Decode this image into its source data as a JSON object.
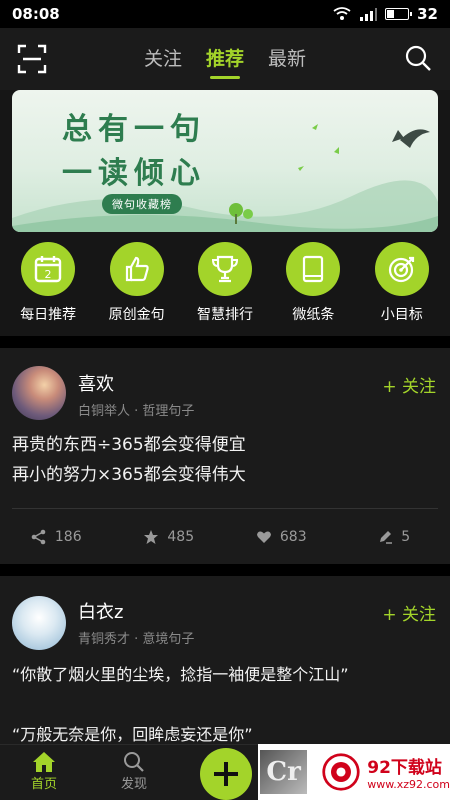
{
  "status_bar": {
    "time": "08:08",
    "battery": "32",
    "battery_level_percent": 32
  },
  "header": {
    "tabs": [
      {
        "label": "关注",
        "active": false
      },
      {
        "label": "推荐",
        "active": true
      },
      {
        "label": "最新",
        "active": false
      }
    ],
    "icons": {
      "left": "scan-icon",
      "right": "search-icon"
    }
  },
  "banner": {
    "line1": "总有一句",
    "line2": "一读倾心",
    "pill": "微句收藏榜"
  },
  "shortcuts": [
    {
      "label": "每日推荐",
      "icon": "calendar-icon",
      "badge": "2"
    },
    {
      "label": "原创金句",
      "icon": "thumbs-up-icon"
    },
    {
      "label": "智慧排行",
      "icon": "trophy-icon"
    },
    {
      "label": "微纸条",
      "icon": "book-icon"
    },
    {
      "label": "小目标",
      "icon": "target-icon"
    }
  ],
  "posts": [
    {
      "user": "喜欢",
      "meta": "白铜举人 · 哲理句子",
      "follow": "+ 关注",
      "lines": [
        "再贵的东西÷365都会变得便宜",
        "再小的努力×365都会变得伟大"
      ],
      "stats": {
        "share": "186",
        "star": "485",
        "like": "683",
        "comment": "5"
      }
    },
    {
      "user": "白衣z",
      "meta": "青铜秀才 · 意境句子",
      "follow": "+ 关注",
      "lines": [
        "“你散了烟火里的尘埃，捻指一袖便是整个江山”",
        "",
        "“万般无奈是你，回眸虑妄还是你”"
      ]
    }
  ],
  "bottom_nav": [
    {
      "label": "首页",
      "active": true
    },
    {
      "label": "发现",
      "active": false
    }
  ],
  "watermark": {
    "cr": "Cr",
    "title": "92下载站",
    "url": "www.xz92.com"
  },
  "colors": {
    "accent": "#a3d42a",
    "background": "#161616",
    "card": "#1b1b1b"
  }
}
